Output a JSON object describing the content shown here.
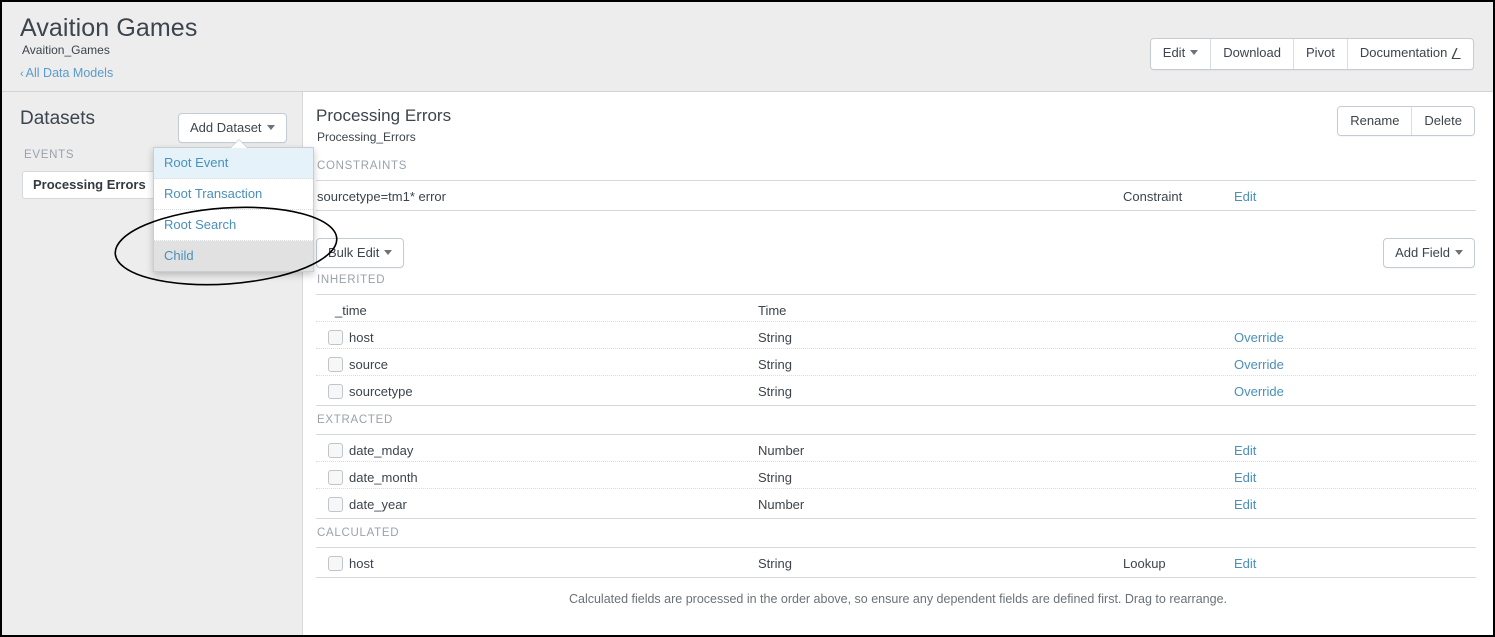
{
  "header": {
    "title": "Avaition Games",
    "subtitle": "Avaition_Games",
    "back_link": "All Data Models",
    "back_chevron": "‹",
    "buttons": [
      {
        "label": "Edit",
        "has_caret": true
      },
      {
        "label": "Download",
        "has_caret": false
      },
      {
        "label": "Pivot",
        "has_caret": false
      },
      {
        "label": "Documentation",
        "has_caret": false,
        "external": true
      }
    ],
    "external_icon": "↗"
  },
  "sidebar": {
    "title": "Datasets",
    "add_dataset_label": "Add Dataset",
    "group_label": "EVENTS",
    "items": [
      {
        "label": "Processing Errors",
        "selected": true
      }
    ],
    "dropdown": {
      "open": true,
      "items": [
        {
          "label": "Root Event",
          "highlight": "blue"
        },
        {
          "label": "Root Transaction",
          "highlight": "none"
        },
        {
          "label": "Root Search",
          "highlight": "none"
        },
        {
          "label": "Child",
          "highlight": "gray"
        }
      ]
    }
  },
  "main": {
    "title": "Processing Errors",
    "subtitle": "Processing_Errors",
    "rename_label": "Rename",
    "delete_label": "Delete",
    "constraints_label": "CONSTRAINTS",
    "constraint_row": {
      "expression": "sourcetype=tm1* error",
      "kind": "Constraint",
      "action": "Edit"
    },
    "bulk_edit_label": "Bulk Edit",
    "add_field_label": "Add Field",
    "sections": [
      {
        "label": "INHERITED",
        "rows": [
          {
            "name": "_time",
            "type": "Time",
            "kind": "",
            "action": "",
            "checkbox": false
          },
          {
            "name": "host",
            "type": "String",
            "kind": "",
            "action": "Override",
            "checkbox": true
          },
          {
            "name": "source",
            "type": "String",
            "kind": "",
            "action": "Override",
            "checkbox": true
          },
          {
            "name": "sourcetype",
            "type": "String",
            "kind": "",
            "action": "Override",
            "checkbox": true
          }
        ]
      },
      {
        "label": "EXTRACTED",
        "rows": [
          {
            "name": "date_mday",
            "type": "Number",
            "kind": "",
            "action": "Edit",
            "checkbox": true
          },
          {
            "name": "date_month",
            "type": "String",
            "kind": "",
            "action": "Edit",
            "checkbox": true
          },
          {
            "name": "date_year",
            "type": "Number",
            "kind": "",
            "action": "Edit",
            "checkbox": true
          }
        ]
      },
      {
        "label": "CALCULATED",
        "rows": [
          {
            "name": "host",
            "type": "String",
            "kind": "Lookup",
            "action": "Edit",
            "checkbox": true
          }
        ]
      }
    ],
    "footer_note": "Calculated fields are processed in the order above, so ensure any dependent fields are defined first. Drag to rearrange."
  },
  "annotation": {
    "shape": "ellipse",
    "color": "#000000",
    "target": "Child"
  },
  "colors": {
    "header_bg": "#ededed",
    "link": "#4a90b9",
    "text": "#3c444d",
    "muted": "#9aa2ab",
    "highlight_blue": "#e5f2fa",
    "highlight_gray": "#e1e1e1"
  }
}
